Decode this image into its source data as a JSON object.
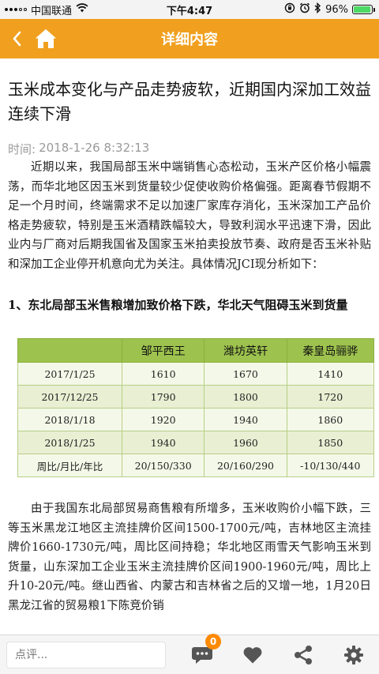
{
  "status_bar": {
    "carrier": "中国联通",
    "time": "下午4:47",
    "battery": "96%",
    "battery_level": 0.96
  },
  "nav": {
    "title": "详细内容",
    "back_icon": "chevron-left-icon",
    "home_icon": "home-icon"
  },
  "article": {
    "title": "玉米成本变化与产品走势疲软，近期国内深加工效益连续下滑",
    "time_label": "时间:",
    "time_value": "2018-1-26 8:32:13",
    "paragraph1": "近期以来，我国局部玉米中端销售心态松动，玉米产区价格小幅震荡，而华北地区因玉米到货量较少促使收购价格偏强。距离春节假期不足一个月时间，终端需求不足以加速厂家库存消化，玉米深加工产品价格走势疲软，特别是玉米酒精跌幅较大，导致利润水平迅速下滑，因此业内与厂商对后期我国省及国家玉米拍卖投放节奏、政府是否玉米补贴和深加工企业停开机意向尤为关注。具体情况JCI现分析如下：",
    "section1": "1、东北局部玉米售粮增加致价格下跌，华北天气阻碍玉米到货量",
    "paragraph2": "由于我国东北局部贸易商售粮有所增多，玉米收购价小幅下跌，三等玉米黑龙江地区主流挂牌价区间1500-1700元/吨，吉林地区主流挂牌价1660-1730元/吨，周比区间持稳；华北地区雨雪天气影响玉米到货量，山东深加工企业玉米主流挂牌价区间1900-1960元/吨，周比上升10-20元/吨。继山西省、内蒙古和吉林省之后的又增一地，1月20日黑龙江省的贸易粮1下陈竞价销"
  },
  "table": {
    "headers": [
      "",
      "邹平西王",
      "潍坊英轩",
      "秦皇岛骊骅"
    ],
    "rows": [
      [
        "2017/1/25",
        "1610",
        "1670",
        "1410"
      ],
      [
        "2017/12/25",
        "1790",
        "1800",
        "1720"
      ],
      [
        "2018/1/18",
        "1920",
        "1940",
        "1860"
      ],
      [
        "2018/1/25",
        "1940",
        "1960",
        "1850"
      ],
      [
        "周比/月比/年比",
        "20/150/330",
        "20/160/290",
        "-10/130/440"
      ]
    ]
  },
  "bottom_bar": {
    "comment_placeholder": "点评...",
    "comment_count": "0",
    "icons": [
      "comment-icon",
      "like-icon",
      "share-icon",
      "settings-icon"
    ]
  },
  "colors": {
    "nav_background": "#f0a01e",
    "table_header": "#9dc24e",
    "badge": "#ff8a00",
    "icon": "#555555"
  }
}
